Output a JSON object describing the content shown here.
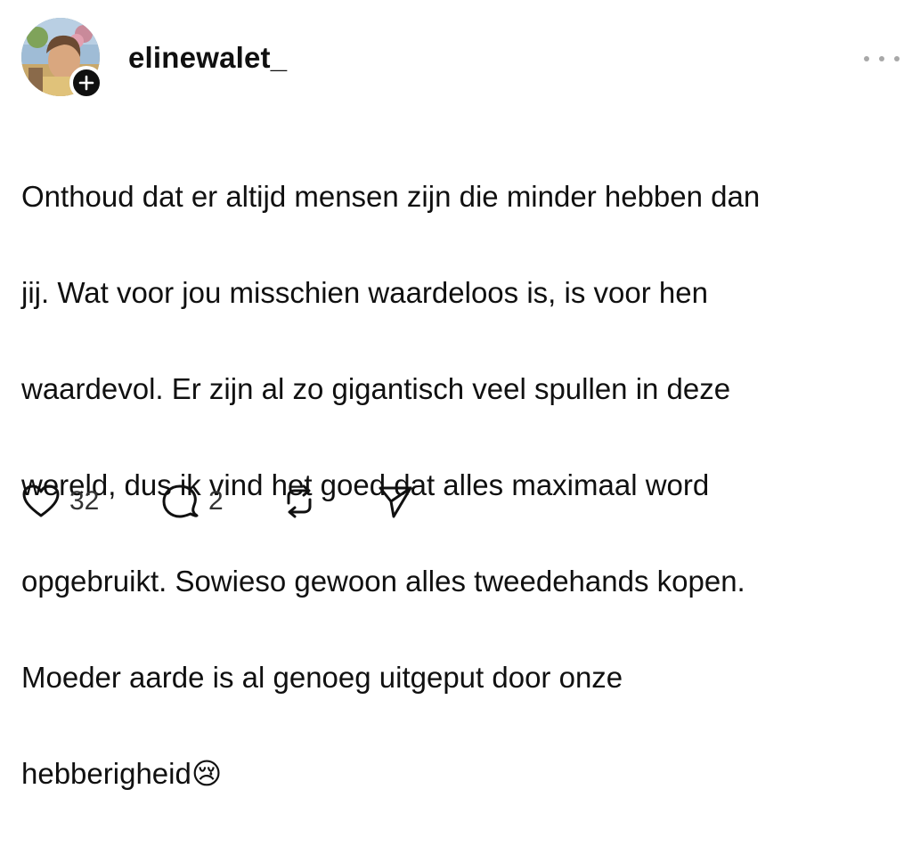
{
  "post": {
    "username": "elinewalet_",
    "text_lines": [
      "Onthoud dat er altijd mensen zijn die minder hebben dan",
      "jij. Wat voor jou misschien waardeloos is, is voor hen",
      "waardevol. Er zijn al zo gigantisch veel spullen in deze",
      "wereld, dus ik vind het goed dat alles maximaal word",
      "opgebruikt. Sowieso gewoon alles tweedehands kopen.",
      "Moeder aarde is al genoeg uitgeput door onze",
      "hebberigheid"
    ],
    "emoji": "😢"
  },
  "actions": {
    "likes": "32",
    "replies": "2"
  },
  "icons": {
    "follow": "plus-icon",
    "more": "more-dots-icon",
    "like": "heart-icon",
    "reply": "reply-bubble-icon",
    "repost": "repost-icon",
    "share": "send-icon"
  },
  "colors": {
    "text": "#101010",
    "muted": "#a8a8a8",
    "badge": "#101010"
  }
}
